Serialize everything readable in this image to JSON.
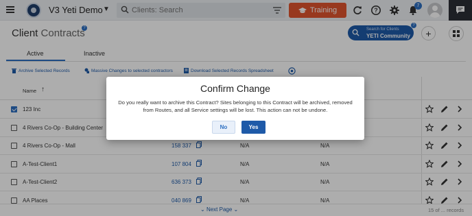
{
  "topbar": {
    "app_title": "V3 Yeti Demo",
    "search_placeholder": "Clients: Search",
    "training_label": "Training",
    "notification_count": "7",
    "colors": {
      "training": "#e0552f",
      "badge": "#2d6fc2"
    }
  },
  "header": {
    "title_main": "Client",
    "title_sub": "Contracts",
    "help_mark": "?",
    "community_sub": "Search for Clients",
    "community_main": "YETI Community"
  },
  "tabs": [
    {
      "label": "Active"
    },
    {
      "label": "Inactive"
    }
  ],
  "toolbar": {
    "archive_label": "Archive Selected Records",
    "massive_label": "Massive Changes to selected contractors",
    "download_label": "Download Selected Records Spreadsheet"
  },
  "table": {
    "header_name": "Name",
    "rows": [
      {
        "name": "123 Inc",
        "number": "",
        "col3": "",
        "col4": "",
        "checked": true
      },
      {
        "name": "4 Rivers Co-Op - Building Center",
        "number": "",
        "col3": "",
        "col4": "",
        "checked": false
      },
      {
        "name": "4 Rivers Co-Op - Mall",
        "number": "158 337",
        "col3": "N/A",
        "col4": "N/A",
        "checked": false
      },
      {
        "name": "A-Test-Client1",
        "number": "107 804",
        "col3": "N/A",
        "col4": "N/A",
        "checked": false
      },
      {
        "name": "A-Test-Client2",
        "number": "636 373",
        "col3": "N/A",
        "col4": "N/A",
        "checked": false
      },
      {
        "name": "AA Places",
        "number": "040 869",
        "col3": "N/A",
        "col4": "N/A",
        "checked": false
      }
    ]
  },
  "footer": {
    "next_page": "Next Page",
    "records": "15 of ... records"
  },
  "modal": {
    "title": "Confirm Change",
    "body": "Do you really want to archive this Contract? Sites belonging to this Contract will be archived, removed from Routes, and all Service settings will be lost. This action can not be undone.",
    "no_label": "No",
    "yes_label": "Yes"
  }
}
